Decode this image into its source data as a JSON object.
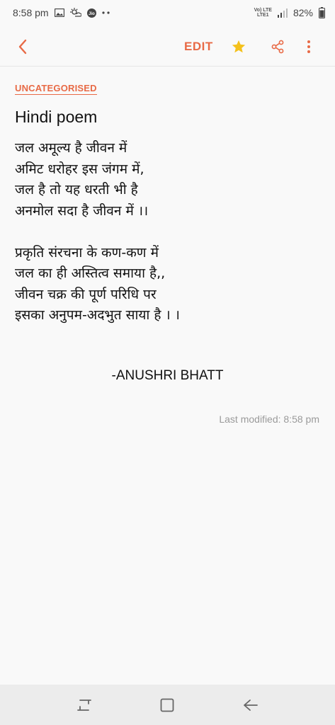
{
  "status_bar": {
    "time": "8:58 pm",
    "network_label_top": "Vo) LTE",
    "network_label_bottom": "LTE1",
    "battery": "82%",
    "icons": [
      "image-icon",
      "weather-icon",
      "jio-icon",
      "dots-icon",
      "volte-icon",
      "signal-icon",
      "battery-icon"
    ]
  },
  "toolbar": {
    "back_icon": "back-arrow-icon",
    "edit_label": "EDIT",
    "star_icon": "star-icon",
    "share_icon": "share-icon",
    "more_icon": "more-vertical-icon",
    "accent_color": "#e86a46",
    "star_color": "#f4c11c"
  },
  "note": {
    "category": "UNCATEGORISED",
    "title": "Hindi poem",
    "body": "जल  अमूल्य  है  जीवन में\nअमिट धरोहर इस जंगम में,\nजल है तो  यह धरती  भी है\nअनमोल सदा  है जीवन में ।।\n\nप्रकृति संरचना के कण-कण में\nजल का ही अस्तित्व समाया है,,\nजीवन चक्र की पूर्ण परिधि पर\nइसका अनुपम-अदभुत साया है । ।",
    "author": "-ANUSHRI BHATT",
    "last_modified": "Last modified: 8:58 pm"
  },
  "nav_bar": {
    "recents_icon": "recent-apps-icon",
    "home_icon": "home-icon",
    "back_icon": "nav-back-icon"
  }
}
